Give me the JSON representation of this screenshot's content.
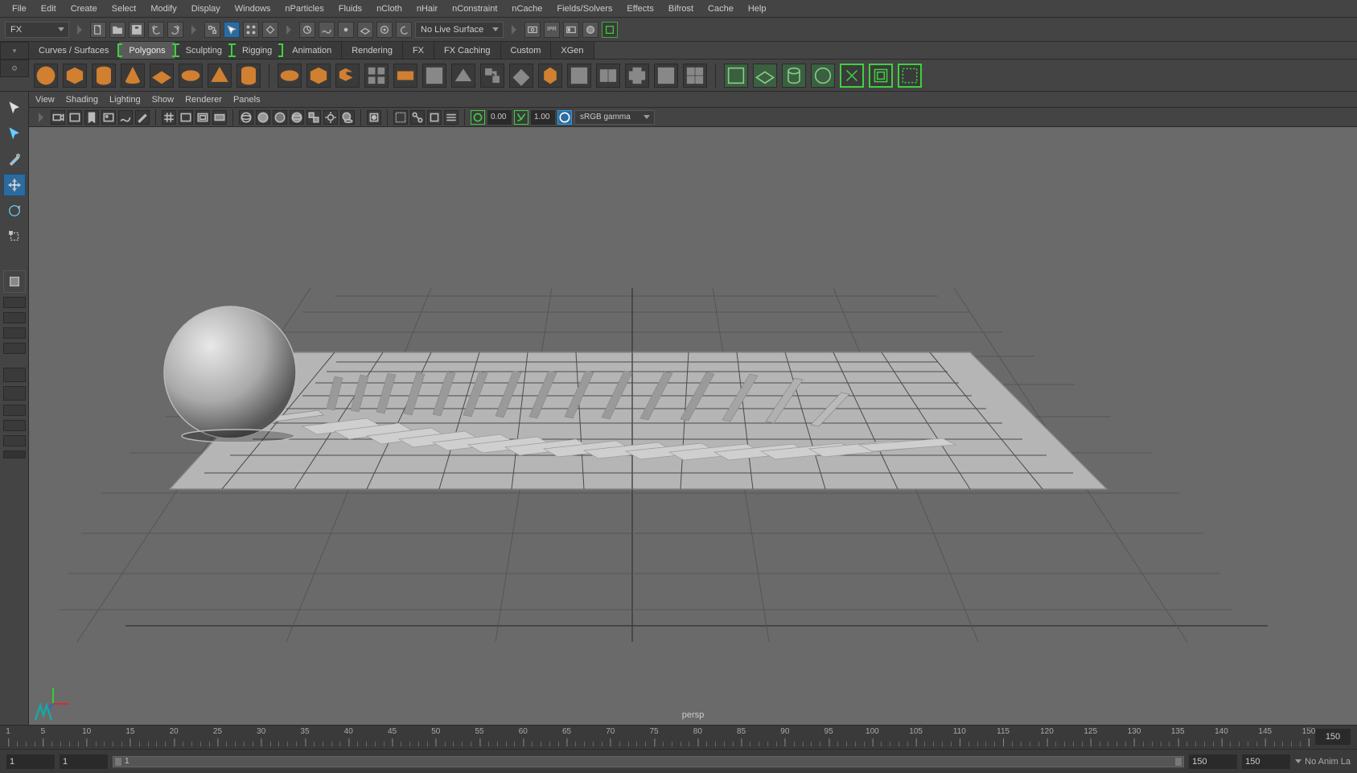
{
  "menubar": [
    "File",
    "Edit",
    "Create",
    "Select",
    "Modify",
    "Display",
    "Windows",
    "nParticles",
    "Fluids",
    "nCloth",
    "nHair",
    "nConstraint",
    "nCache",
    "Fields/Solvers",
    "Effects",
    "Bifrost",
    "Cache",
    "Help"
  ],
  "workspace_dropdown": "FX",
  "statusline": {
    "live_surface": "No Live Surface"
  },
  "shelf_tabs": [
    {
      "label": "Curves / Surfaces",
      "active": false,
      "bracket": false
    },
    {
      "label": "Polygons",
      "active": true,
      "bracket": true
    },
    {
      "label": "Sculpting",
      "active": false,
      "bracket": true
    },
    {
      "label": "Rigging",
      "active": false,
      "bracket": true
    },
    {
      "label": "Animation",
      "active": false,
      "bracket": false
    },
    {
      "label": "Rendering",
      "active": false,
      "bracket": false
    },
    {
      "label": "FX",
      "active": false,
      "bracket": false
    },
    {
      "label": "FX Caching",
      "active": false,
      "bracket": false
    },
    {
      "label": "Custom",
      "active": false,
      "bracket": false
    },
    {
      "label": "XGen",
      "active": false,
      "bracket": false
    }
  ],
  "panel_menu": [
    "View",
    "Shading",
    "Lighting",
    "Show",
    "Renderer",
    "Panels"
  ],
  "panel_toolbar": {
    "exposure": "0.00",
    "gamma": "1.00",
    "colorspace": "sRGB gamma"
  },
  "viewport": {
    "camera": "persp"
  },
  "timeline": {
    "ticks": [
      1,
      5,
      10,
      15,
      20,
      25,
      30,
      35,
      40,
      45,
      50,
      55,
      60,
      65,
      70,
      75,
      80,
      85,
      90,
      95,
      100,
      105,
      110,
      115,
      120,
      125,
      130,
      135,
      140,
      145,
      150
    ],
    "current_frame": "150",
    "head_label": "150"
  },
  "range": {
    "start_outer": "1",
    "start_inner": "1",
    "inner_label": "1",
    "end_inner": "150",
    "end_outer": "150",
    "anim_layer_status": "No Anim La"
  }
}
